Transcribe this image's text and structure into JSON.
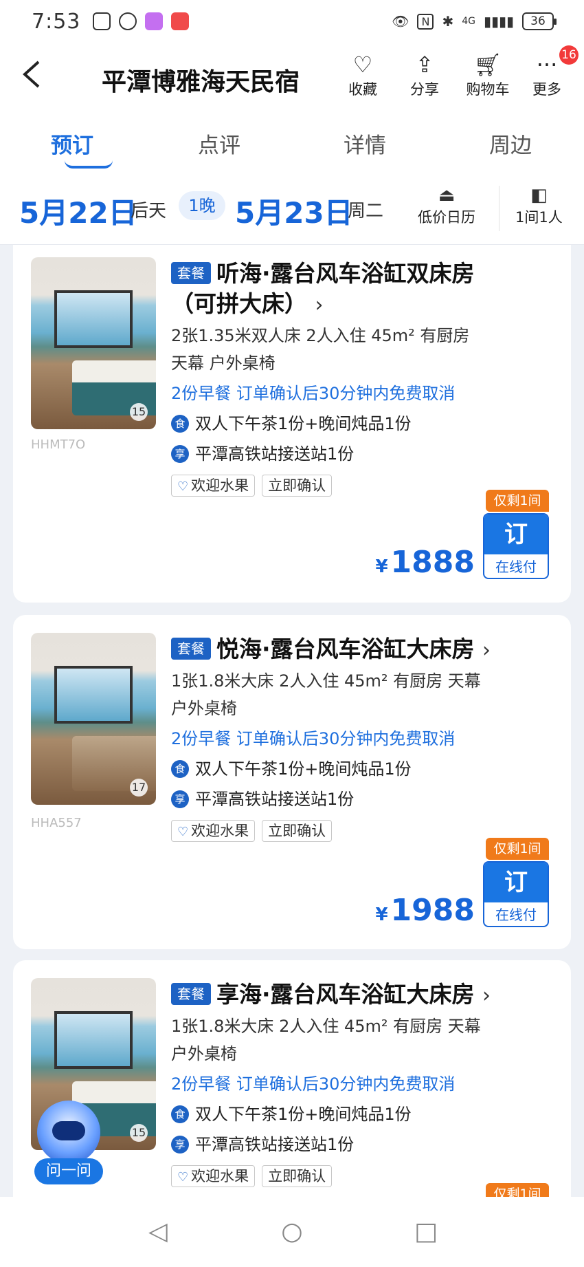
{
  "status": {
    "time": "7:53",
    "network": "4G",
    "battery": "36",
    "app_icon_colors": [
      "#ffffff",
      "#ffffff",
      "#c46ff0",
      "#f04a4a"
    ]
  },
  "header": {
    "title": "平潭博雅海天民宿",
    "favorite_label": "收藏",
    "share_label": "分享",
    "cart_label": "购物车",
    "more_label": "更多",
    "more_badge": "16"
  },
  "tabs": [
    "预订",
    "点评",
    "详情",
    "周边"
  ],
  "dates": {
    "checkin": "5月22日",
    "checkin_sub": "后天",
    "nights": "1晚",
    "checkout": "5月23日",
    "checkout_sub": "周二",
    "calendar_label": "低价日历",
    "guests_label": "1间1人"
  },
  "rooms": [
    {
      "package_tag": "套餐",
      "title_line1": "听海·露台风车浴缸双床房",
      "title_line2": "（可拼大床）",
      "spec_line1": "2张1.35米双人床  2人入住  45m²  有厨房",
      "spec_line2": "天幕  户外桌椅",
      "policy": "2份早餐   订单确认后30分钟内免费取消",
      "perk1_icon": "食",
      "perk1": "双人下午茶1份+晚间炖品1份",
      "perk2_icon": "享",
      "perk2": "平潭高铁站接送站1份",
      "tag1": "欢迎水果",
      "tag2": "立即确认",
      "photo_count": "15",
      "code": "HHMT7O",
      "remain": "仅剩1间",
      "currency": "¥",
      "price": "1888",
      "book_main": "订",
      "book_sub": "在线付"
    },
    {
      "package_tag": "套餐",
      "title_line1": "悦海·露台风车浴缸大床房",
      "spec_line1": "1张1.8米大床  2人入住  45m²  有厨房  天幕",
      "spec_line2": "户外桌椅",
      "policy": "2份早餐   订单确认后30分钟内免费取消",
      "perk1_icon": "食",
      "perk1": "双人下午茶1份+晚间炖品1份",
      "perk2_icon": "享",
      "perk2": "平潭高铁站接送站1份",
      "tag1": "欢迎水果",
      "tag2": "立即确认",
      "photo_count": "17",
      "code": "HHA557",
      "remain": "仅剩1间",
      "currency": "¥",
      "price": "1988",
      "book_main": "订",
      "book_sub": "在线付"
    },
    {
      "package_tag": "套餐",
      "title_line1": "享海·露台风车浴缸大床房",
      "spec_line1": "1张1.8米大床  2人入住  45m²  有厨房  天幕",
      "spec_line2": "户外桌椅",
      "policy": "2份早餐   订单确认后30分钟内免费取消",
      "perk1_icon": "食",
      "perk1": "双人下午茶1份+晚间炖品1份",
      "perk2_icon": "享",
      "perk2": "平潭高铁站接送站1份",
      "tag1": "欢迎水果",
      "tag2": "立即确认",
      "photo_count": "15",
      "remain": "仅剩1间"
    }
  ],
  "assistant_label": "问一问",
  "colors": {
    "accent": "#1765d8",
    "orange": "#f07a1a",
    "badge": "#f23a3a"
  }
}
